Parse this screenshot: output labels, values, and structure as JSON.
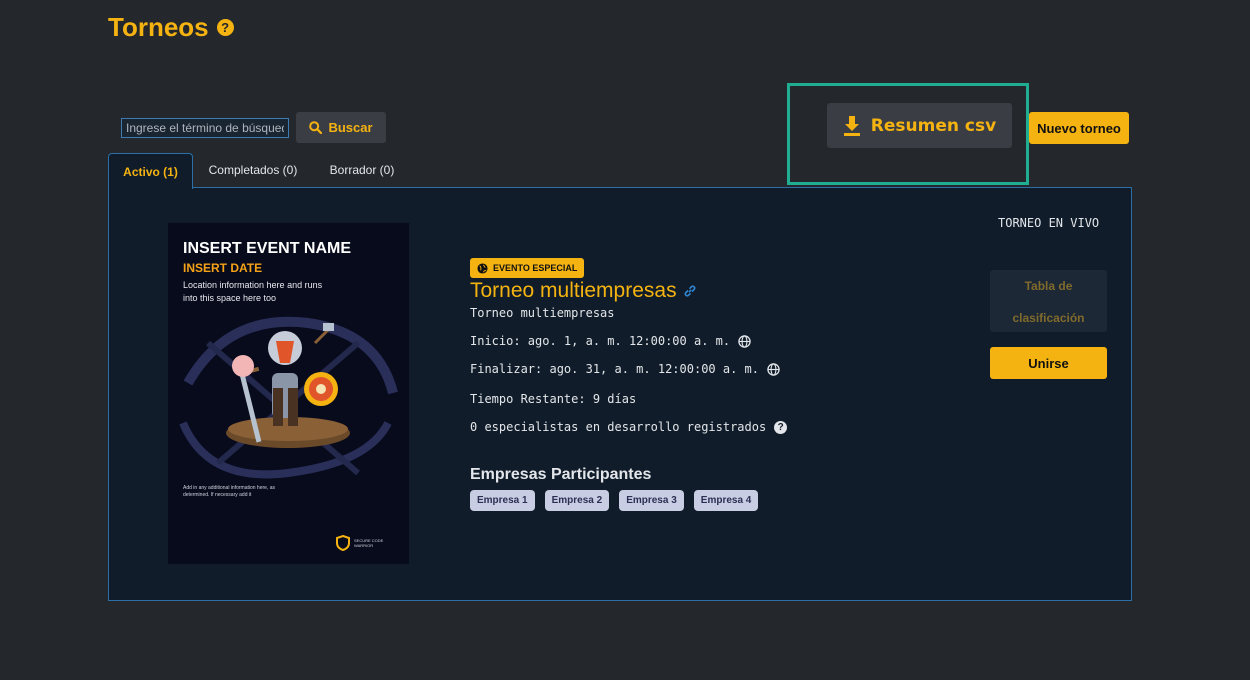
{
  "header": {
    "title": "Torneos",
    "help_icon": "?"
  },
  "search": {
    "placeholder": "Ingrese el término de búsqueda",
    "button_label": "Buscar"
  },
  "toolbar": {
    "csv_label": "Resumen csv",
    "new_label": "Nuevo torneo"
  },
  "tabs": [
    {
      "label": "Activo (1)"
    },
    {
      "label": "Completados (0)"
    },
    {
      "label": "Borrador (0)"
    }
  ],
  "card": {
    "poster": {
      "event_name": "INSERT EVENT NAME",
      "event_date": "INSERT DATE",
      "location": "Location information here and runs into this space here too",
      "footer": "Add in any additional information here, as determined. If necessary add it",
      "logo_text": "SECURE CODE WARRIOR"
    },
    "badge": "EVENTO ESPECIAL",
    "title": "Torneo multiempresas",
    "description": "Torneo multiempresas",
    "start": "Inicio: ago. 1, a. m. 12:00:00 a. m.",
    "end": "Finalizar: ago. 31, a. m. 12:00:00 a. m.",
    "remaining": "Tiempo Restante: 9 días",
    "registered": "0 especialistas en desarrollo registrados",
    "companies_title": "Empresas Participantes",
    "companies": [
      "Empresa 1",
      "Empresa 2",
      "Empresa 3",
      "Empresa 4"
    ],
    "live_label": "TORNEO EN VIVO",
    "ranking_line1": "Tabla de",
    "ranking_line2": "clasificación",
    "join_label": "Unirse"
  },
  "colors": {
    "accent": "#f5b312",
    "background": "#24272c",
    "panel": "#101c29",
    "highlight": "#1fae92",
    "chip": "#c9cde4"
  }
}
